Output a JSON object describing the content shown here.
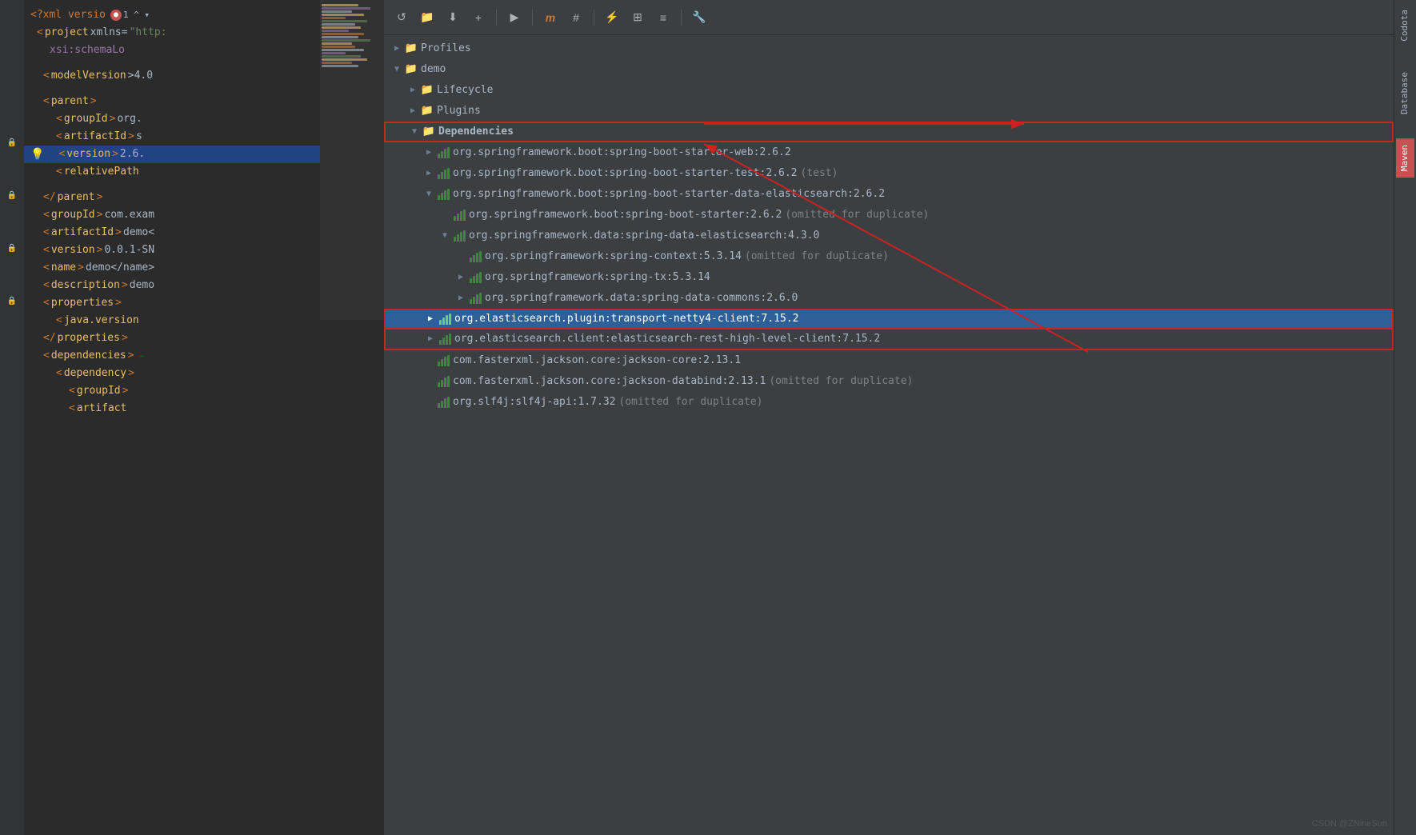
{
  "editor": {
    "lines": [
      {
        "indent": 0,
        "content": "<?xml versio",
        "suffix": "",
        "type": "xml-tag-open",
        "error": true,
        "arrow_count": "1",
        "arrow_dir": "^"
      },
      {
        "indent": 2,
        "content": "<project xmlns=\"http:",
        "suffix": "",
        "type": "xml-tag"
      },
      {
        "indent": 4,
        "content": "xsi:schemaLo",
        "suffix": "",
        "type": "xml-attr"
      },
      {
        "indent": 2,
        "content": "",
        "suffix": "",
        "type": "blank"
      },
      {
        "indent": 2,
        "content": "<modelVersion>4.0",
        "suffix": "",
        "type": "xml-tag"
      },
      {
        "indent": 2,
        "content": "",
        "suffix": "",
        "type": "blank"
      },
      {
        "indent": 2,
        "content": "<parent>",
        "suffix": "",
        "type": "xml-tag"
      },
      {
        "indent": 4,
        "content": "<groupId>org.",
        "suffix": "",
        "type": "xml-tag"
      },
      {
        "indent": 4,
        "content": "<artifactId>s",
        "suffix": "",
        "type": "xml-tag"
      },
      {
        "indent": 4,
        "content": "<version>2.6.",
        "suffix": "",
        "type": "xml-tag",
        "highlighted": true,
        "lightbulb": true
      },
      {
        "indent": 4,
        "content": "<relativePath",
        "suffix": "",
        "type": "xml-tag"
      },
      {
        "indent": 2,
        "content": "",
        "suffix": "",
        "type": "blank"
      },
      {
        "indent": 2,
        "content": "</parent>",
        "suffix": "",
        "type": "xml-tag"
      },
      {
        "indent": 2,
        "content": "<groupId>com.exam",
        "suffix": "",
        "type": "xml-tag"
      },
      {
        "indent": 2,
        "content": "<artifactId>demo<",
        "suffix": "",
        "type": "xml-tag"
      },
      {
        "indent": 2,
        "content": "<version>0.0.1-SN",
        "suffix": "",
        "type": "xml-tag"
      },
      {
        "indent": 2,
        "content": "<name>demo</name>",
        "suffix": "",
        "type": "xml-tag"
      },
      {
        "indent": 2,
        "content": "<description>demo",
        "suffix": "",
        "type": "xml-tag"
      },
      {
        "indent": 2,
        "content": "<properties>",
        "suffix": "",
        "type": "xml-tag"
      },
      {
        "indent": 4,
        "content": "<java.version",
        "suffix": "",
        "type": "xml-tag"
      },
      {
        "indent": 2,
        "content": "</properties>",
        "suffix": "",
        "type": "xml-tag"
      },
      {
        "indent": 2,
        "content": "<dependencies>",
        "suffix": "",
        "type": "xml-tag"
      },
      {
        "indent": 4,
        "content": "<dependency>",
        "suffix": "",
        "type": "xml-tag"
      },
      {
        "indent": 6,
        "content": "<groupId>",
        "suffix": "",
        "type": "xml-tag"
      },
      {
        "indent": 6,
        "content": "<artifact",
        "suffix": "",
        "type": "xml-tag"
      }
    ]
  },
  "maven": {
    "toolbar": {
      "buttons": [
        "↺",
        "📁",
        "⬇",
        "+",
        "▶",
        "m",
        "#",
        "⚡",
        "⊞",
        "≡",
        "🔧"
      ]
    },
    "tree": {
      "items": [
        {
          "id": "profiles",
          "label": "Profiles",
          "indent": 0,
          "arrow": "collapsed",
          "icon": "folder",
          "type": "profiles"
        },
        {
          "id": "demo",
          "label": "demo",
          "indent": 0,
          "arrow": "expanded",
          "icon": "folder",
          "type": "project"
        },
        {
          "id": "lifecycle",
          "label": "Lifecycle",
          "indent": 1,
          "arrow": "collapsed",
          "icon": "folder",
          "type": "lifecycle"
        },
        {
          "id": "plugins",
          "label": "Plugins",
          "indent": 1,
          "arrow": "collapsed",
          "icon": "folder",
          "type": "plugins"
        },
        {
          "id": "dependencies",
          "label": "Dependencies",
          "indent": 1,
          "arrow": "expanded",
          "icon": "folder",
          "type": "dependencies",
          "boxed": true
        },
        {
          "id": "dep1",
          "label": "org.springframework.boot:spring-boot-starter-web:2.6.2",
          "indent": 2,
          "arrow": "collapsed",
          "icon": "dep",
          "type": "dependency"
        },
        {
          "id": "dep2",
          "label": "org.springframework.boot:spring-boot-starter-test:2.6.2",
          "suffix": "(test)",
          "indent": 2,
          "arrow": "collapsed",
          "icon": "dep",
          "type": "dependency"
        },
        {
          "id": "dep3",
          "label": "org.springframework.boot:spring-boot-starter-data-elasticsearch:2.6.2",
          "indent": 2,
          "arrow": "expanded",
          "icon": "dep",
          "type": "dependency"
        },
        {
          "id": "dep3-1",
          "label": "org.springframework.boot:spring-boot-starter:2.6.2",
          "suffix": "(omitted for duplicate)",
          "indent": 3,
          "arrow": "empty",
          "icon": "dep",
          "type": "dependency"
        },
        {
          "id": "dep3-2",
          "label": "org.springframework.data:spring-data-elasticsearch:4.3.0",
          "indent": 3,
          "arrow": "expanded",
          "icon": "dep",
          "type": "dependency"
        },
        {
          "id": "dep3-2-1",
          "label": "org.springframework:spring-context:5.3.14",
          "suffix": "(omitted for duplicate)",
          "indent": 4,
          "arrow": "empty",
          "icon": "dep",
          "type": "dependency"
        },
        {
          "id": "dep3-2-2",
          "label": "org.springframework:spring-tx:5.3.14",
          "indent": 4,
          "arrow": "collapsed",
          "icon": "dep",
          "type": "dependency"
        },
        {
          "id": "dep3-2-3",
          "label": "org.springframework.data:spring-data-commons:2.6.0",
          "indent": 4,
          "arrow": "collapsed",
          "icon": "dep",
          "type": "dependency"
        },
        {
          "id": "dep4",
          "label": "org.elasticsearch.plugin:transport-netty4-client:7.15.2",
          "indent": 2,
          "arrow": "collapsed",
          "icon": "dep",
          "type": "dependency",
          "selected": true,
          "boxed2": true
        },
        {
          "id": "dep5",
          "label": "org.elasticsearch.client:elasticsearch-rest-high-level-client:7.15.2",
          "indent": 2,
          "arrow": "collapsed",
          "icon": "dep",
          "type": "dependency",
          "boxed2": true
        },
        {
          "id": "dep6",
          "label": "com.fasterxml.jackson.core:jackson-core:2.13.1",
          "indent": 2,
          "arrow": "empty",
          "icon": "dep",
          "type": "dependency"
        },
        {
          "id": "dep7",
          "label": "com.fasterxml.jackson.core:jackson-databind:2.13.1",
          "suffix": "(omitted for duplicate)",
          "indent": 2,
          "arrow": "empty",
          "icon": "dep",
          "type": "dependency"
        },
        {
          "id": "dep8",
          "label": "org.slf4j:slf4j-api:1.7.32",
          "suffix": "(omitted for duplicate)",
          "indent": 2,
          "arrow": "empty",
          "icon": "dep",
          "type": "dependency"
        }
      ]
    }
  },
  "sidebar": {
    "tabs": [
      {
        "id": "codota",
        "label": "Codota",
        "active": false
      },
      {
        "id": "database",
        "label": "Database",
        "active": false
      },
      {
        "id": "maven",
        "label": "Maven",
        "active": true
      }
    ]
  },
  "watermark": "CSDN @ZNineSun"
}
